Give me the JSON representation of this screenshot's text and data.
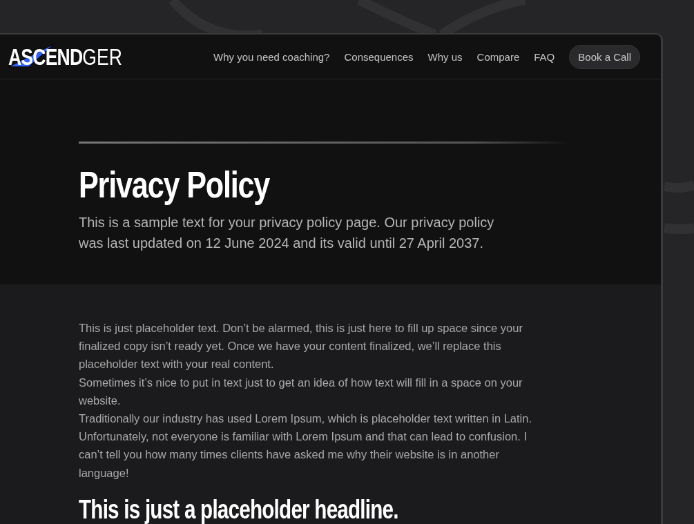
{
  "logo": {
    "bold": "ASCEND",
    "light": "GER"
  },
  "nav": {
    "links": [
      "Why you need coaching?",
      "Consequences",
      "Why us",
      "Compare",
      "FAQ"
    ],
    "cta": "Book a Call"
  },
  "hero": {
    "title": "Privacy Policy",
    "subtitle": "This is a sample text for your privacy policy page. Our privacy policy was last updated on 12 June 2024 and its valid until 27 April 2037."
  },
  "body": {
    "paragraphs": [
      "This is just placeholder text. Don’t be alarmed, this is just here to fill up space since your finalized copy isn’t ready yet. Once we have your content finalized, we’ll replace this placeholder text with your real content.",
      "Sometimes it’s nice to put in text just to get an idea of how text will fill in a space on your website.",
      "Traditionally our industry has used Lorem Ipsum, which is placeholder text written in Latin. Unfortunately, not everyone is familiar with Lorem Ipsum and that can lead to confusion. I can’t tell you how many times clients have asked me why their website is in another language!"
    ],
    "headline": "This is just a placeholder headline."
  }
}
